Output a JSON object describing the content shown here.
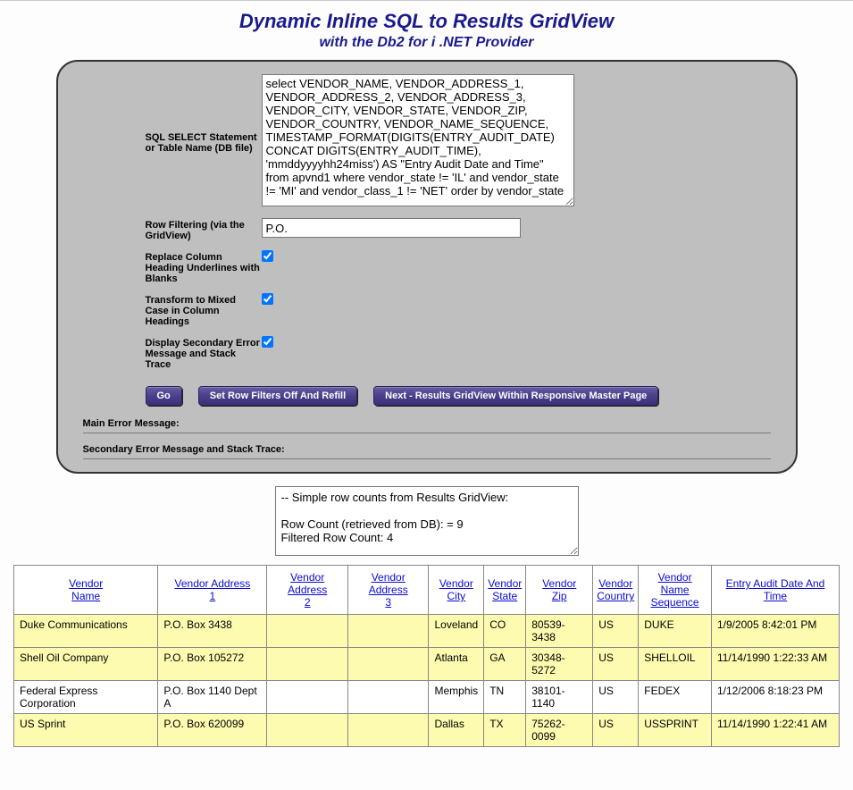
{
  "header": {
    "title": "Dynamic Inline SQL to Results GridView",
    "subtitle": "with the Db2 for i .NET Provider"
  },
  "form": {
    "sql_label": "SQL SELECT Statement or Table Name (DB file)",
    "sql_value": "select VENDOR_NAME, VENDOR_ADDRESS_1, VENDOR_ADDRESS_2, VENDOR_ADDRESS_3, VENDOR_CITY, VENDOR_STATE, VENDOR_ZIP, VENDOR_COUNTRY, VENDOR_NAME_SEQUENCE, TIMESTAMP_FORMAT(DIGITS(ENTRY_AUDIT_DATE) CONCAT DIGITS(ENTRY_AUDIT_TIME), 'mmddyyyyhh24miss') AS \"Entry Audit Date and Time\" from apvnd1 where vendor_state != 'IL' and vendor_state != 'MI' and vendor_class_1 != 'NET' order by vendor_state",
    "filter_label": "Row Filtering (via the GridView)",
    "filter_value": "P.O.",
    "replace_label": "Replace Column Heading Underlines with Blanks",
    "replace_checked": true,
    "mixed_label": "Transform to Mixed Case in Column Headings",
    "mixed_checked": true,
    "secondary_label": "Display Secondary Error Message and Stack Trace",
    "secondary_checked": true
  },
  "buttons": {
    "go": "Go",
    "refill": "Set Row Filters Off And Refill",
    "next": "Next - Results GridView Within Responsive Master Page"
  },
  "messages": {
    "main_label": "Main Error Message:",
    "secondary_label": "Secondary Error Message and Stack Trace:"
  },
  "counts_text": "-- Simple row counts from Results GridView:\n\nRow Count (retrieved from DB): = 9\nFiltered Row Count: 4",
  "grid": {
    "headers": [
      "Vendor Name",
      "Vendor Address 1",
      "Vendor Address 2",
      "Vendor Address 3",
      "Vendor City",
      "Vendor State",
      "Vendor Zip",
      "Vendor Country",
      "Vendor Name Sequence",
      "Entry Audit Date And Time"
    ],
    "rows": [
      {
        "alt": true,
        "cells": [
          "Duke Communications",
          "P.O. Box 3438",
          "",
          "",
          "Loveland",
          "CO",
          "80539-3438",
          "US",
          "DUKE",
          "1/9/2005 8:42:01 PM"
        ]
      },
      {
        "alt": true,
        "cells": [
          "Shell Oil Company",
          "P.O. Box 105272",
          "",
          "",
          "Atlanta",
          "GA",
          "30348-5272",
          "US",
          "SHELLOIL",
          "11/14/1990 1:22:33 AM"
        ]
      },
      {
        "alt": false,
        "cells": [
          "Federal Express Corporation",
          "P.O. Box 1140 Dept A",
          "",
          "",
          "Memphis",
          "TN",
          "38101-1140",
          "US",
          "FEDEX",
          "1/12/2006 8:18:23 PM"
        ]
      },
      {
        "alt": true,
        "cells": [
          "US Sprint",
          "P.O. Box 620099",
          "",
          "",
          "Dallas",
          "TX",
          "75262-0099",
          "US",
          "USSPRINT",
          "11/14/1990 1:22:41 AM"
        ]
      }
    ]
  }
}
